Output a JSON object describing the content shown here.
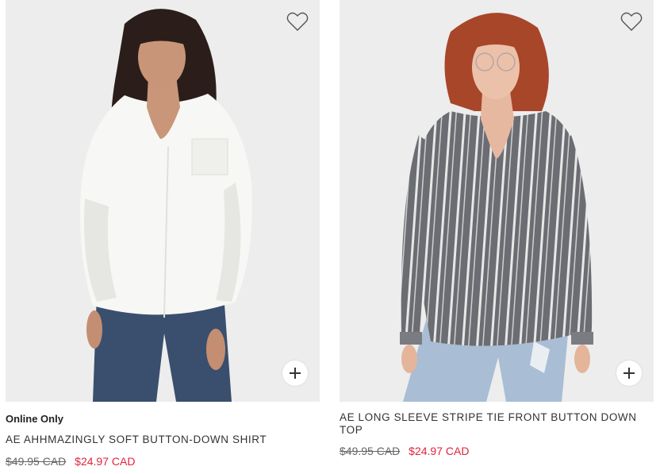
{
  "products": [
    {
      "badge": "Online Only",
      "name": "AE AHHMAZINGLY SOFT BUTTON-DOWN SHIRT",
      "list_price": "$49.95 CAD",
      "sale_price": "$24.97 CAD",
      "image_icon": "model-white-shirt-photo"
    },
    {
      "badge": "",
      "name": "AE LONG SLEEVE STRIPE TIE FRONT BUTTON DOWN TOP",
      "list_price": "$49.95 CAD",
      "sale_price": "$24.97 CAD",
      "image_icon": "model-striped-shirt-photo"
    }
  ],
  "icons": {
    "favorite": "heart-outline-icon",
    "quick_add": "plus-icon"
  },
  "colors": {
    "sale": "#e0243c",
    "image_bg": "#ededed",
    "text": "#333333"
  }
}
